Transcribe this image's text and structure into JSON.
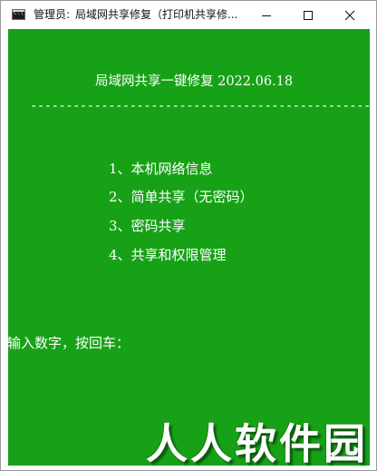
{
  "window": {
    "title_prefix": "管理员:",
    "title_main": "局域网共享修复（打印机共享修...",
    "icon_text": "C:\\"
  },
  "console": {
    "background": "#17a117",
    "header": "局域网共享一键修复 2022.06.18",
    "divider": "--------------------------------------------------",
    "menu": [
      {
        "label": "1、本机网络信息"
      },
      {
        "label": "2、简单共享（无密码）"
      },
      {
        "label": "3、密码共享"
      },
      {
        "label": "4、共享和权限管理"
      }
    ],
    "prompt": "输入数字，按回车："
  },
  "watermark": {
    "text": "人人软件园"
  },
  "icons": {
    "minimize": "minimize-icon",
    "maximize": "maximize-icon",
    "close": "close-icon"
  }
}
